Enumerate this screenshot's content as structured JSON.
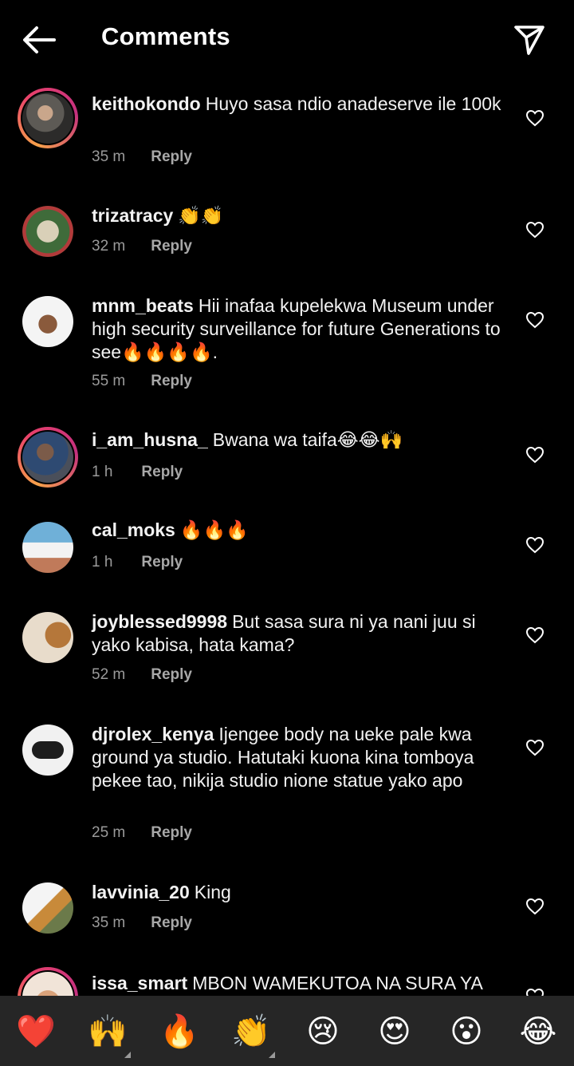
{
  "header": {
    "title": "Comments"
  },
  "comments": [
    {
      "user": "keithokondo",
      "text": "Huyo sasa ndio anadeserve ile 100k",
      "time": "35 m",
      "reply": "Reply"
    },
    {
      "user": "trizatracy",
      "text": "👏👏",
      "time": "32 m",
      "reply": "Reply"
    },
    {
      "user": "mnm_beats",
      "text": "Hii inafaa kupelekwa Museum under high security surveillance  for future Generations to see🔥🔥🔥🔥.",
      "time": "55 m",
      "reply": "Reply"
    },
    {
      "user": "i_am_husna_",
      "text": "Bwana wa taifa😂😂🙌",
      "time": "1 h",
      "reply": "Reply"
    },
    {
      "user": "cal_moks",
      "text": "🔥🔥🔥",
      "time": "1 h",
      "reply": "Reply"
    },
    {
      "user": "joyblessed9998",
      "text": "But sasa sura ni ya nani juu si yako kabisa, hata kama?",
      "time": "52 m",
      "reply": "Reply"
    },
    {
      "user": "djrolex_kenya",
      "text": "Ijengee body na ueke pale kwa ground ya studio. Hatutaki kuona kina tomboya pekee tao, nikija studio nione statue yako apo",
      "time": "25 m",
      "reply": "Reply"
    },
    {
      "user": "lavvinia_20",
      "text": "King",
      "time": "35 m",
      "reply": "Reply"
    },
    {
      "user": "issa_smart",
      "text": "MBON WAMEKUTOA NA SURA YA"
    }
  ],
  "reactions": [
    "❤️",
    "🙌",
    "🔥",
    "👏",
    "😢",
    "😍",
    "😮",
    "😂"
  ],
  "colors": {
    "background": "#000000",
    "bar": "#262626",
    "meta": "#9a9a9a",
    "ring_start": "#f6a14a",
    "ring_end": "#c4307f"
  }
}
